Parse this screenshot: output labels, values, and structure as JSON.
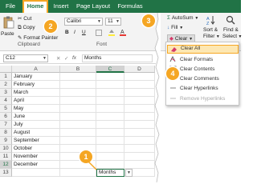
{
  "menu": {
    "tabs": [
      "File",
      "Home",
      "Insert",
      "Page Layout",
      "Formulas"
    ]
  },
  "ribbon": {
    "paste_label": "Paste",
    "cut_label": "Cut",
    "copy_label": "Copy",
    "format_painter_label": "Format Painter",
    "clipboard_label": "Clipboard",
    "font_name": "Calibri",
    "font_size": "11",
    "font_label": "Font",
    "autosum_label": "AutoSum",
    "fill_label": "Fill",
    "clear_label": "Clear",
    "sort_filter_label": "Sort &",
    "sort_filter_label2": "Filter",
    "find_select_label": "Find &",
    "find_select_label2": "Select",
    "bold": "B",
    "italic": "I",
    "underline": "U"
  },
  "formula_bar": {
    "name_box": "C12",
    "fx": "fx",
    "value": "Months"
  },
  "grid": {
    "columns": [
      "A",
      "B",
      "C",
      "D"
    ],
    "rows": [
      "1",
      "2",
      "3",
      "4",
      "5",
      "6",
      "7",
      "8",
      "9",
      "10",
      "11",
      "12",
      "13"
    ],
    "cells": [
      "January",
      "February",
      "March",
      "April",
      "May",
      "June",
      "July",
      "August",
      "September",
      "October",
      "November",
      "December",
      ""
    ],
    "active_cell_value": "Months"
  },
  "clear_menu": {
    "items": [
      "Clear All",
      "Clear Formats",
      "Clear Contents",
      "Clear Comments",
      "Clear Hyperlinks",
      "Remove Hyperlinks"
    ]
  },
  "steps": [
    "1",
    "2",
    "3",
    "4"
  ],
  "colors": {
    "excel_green": "#217346",
    "step_orange": "#f5a623",
    "highlight": "#fde7b2"
  }
}
